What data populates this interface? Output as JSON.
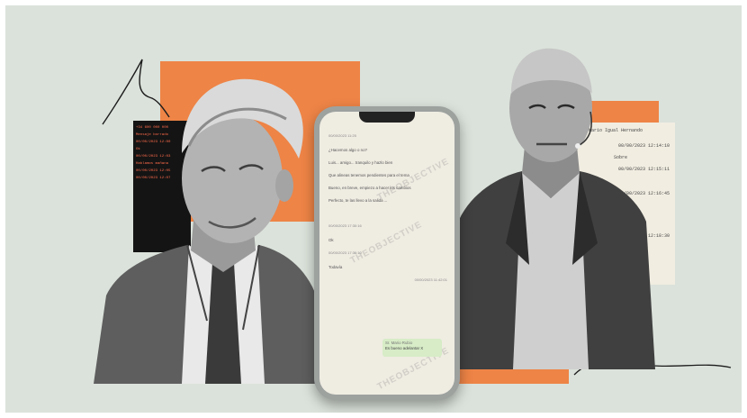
{
  "phone": {
    "timestamp_top": "00/00/2023 11:25",
    "messages": [
      "¿Hacemos algo o no?",
      "Luis... amigo... tranquilo y hazlo bien",
      "Que alineas tenemos pendientes para el tema",
      "Bueno, en breve, empiezo a hacer los cambios",
      "Perfecto, te las llevo a la salida ..."
    ],
    "time_a": "00/00/2023 17:30:16",
    "short_a": "Ok",
    "time_b": "00/00/2023 17:36:10",
    "short_b": "Todavía",
    "time_c": "00/00/2023 11:42:01",
    "bubble_name": "Sr. Mario Rubio",
    "bubble_text": "Es bueno adelantar X",
    "watermark": "THEOBJECTIVE"
  },
  "right_paper": {
    "header": "Sr. Mario Igual Hernando",
    "lines": [
      "00/00/2023 12:14:10",
      "Sobre",
      "00/00/2023 12:15:11",
      "00/00/2023 12:16:45",
      "00/00/2023 12:18:30"
    ]
  },
  "dark_clip": {
    "lines": [
      "+34 600 000 000",
      "Mensaje borrado",
      "00/00/2023 12:00",
      "Ok",
      "00/00/2023 12:03",
      "Hablamos mañana",
      "00/00/2023 12:05",
      "00/00/2023 12:07"
    ]
  },
  "colors": {
    "background": "#dbe2db",
    "accent": "#ee8446",
    "paper": "#f1ede1",
    "bubble": "#d7ecc7"
  }
}
